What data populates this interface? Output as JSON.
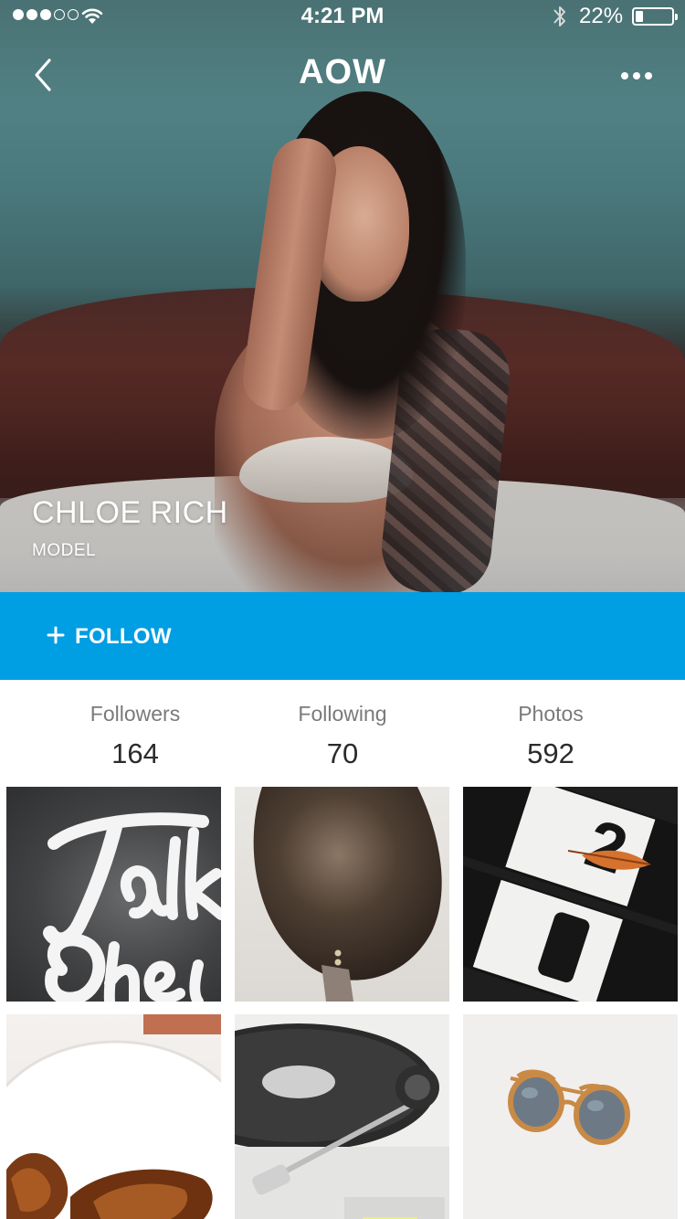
{
  "status_bar": {
    "time": "4:21 PM",
    "battery_text": "22%",
    "battery_level": 0.22,
    "signal_bars_filled": 3,
    "signal_bars_total": 5,
    "icons": [
      "signal-dots-icon",
      "wifi-icon",
      "bluetooth-icon",
      "battery-icon"
    ]
  },
  "nav": {
    "title": "AOW",
    "back_icon": "chevron-left-icon",
    "more_icon": "ellipsis-icon"
  },
  "profile": {
    "name": "CHLOE RICH",
    "role": "MODEL"
  },
  "follow": {
    "label": "FOLLOW",
    "icon": "plus-icon",
    "color": "#009ee3"
  },
  "stats": [
    {
      "label": "Followers",
      "value": "164"
    },
    {
      "label": "Following",
      "value": "70"
    },
    {
      "label": "Photos",
      "value": "592"
    }
  ],
  "photo_grid": {
    "tiles": [
      {
        "subject": "lettering-art"
      },
      {
        "subject": "bronze-object"
      },
      {
        "subject": "wine-bottles"
      },
      {
        "subject": "food-plate"
      },
      {
        "subject": "turntable"
      },
      {
        "subject": "sunglasses"
      }
    ]
  }
}
